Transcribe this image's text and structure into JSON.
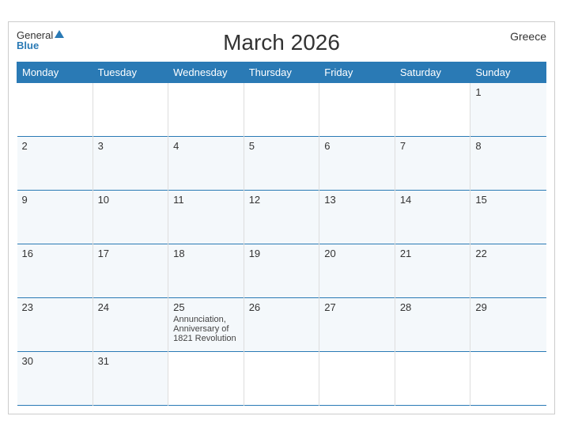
{
  "header": {
    "title": "March 2026",
    "country": "Greece",
    "logo_general": "General",
    "logo_blue": "Blue"
  },
  "days_of_week": [
    "Monday",
    "Tuesday",
    "Wednesday",
    "Thursday",
    "Friday",
    "Saturday",
    "Sunday"
  ],
  "weeks": [
    [
      {
        "day": "",
        "empty": true
      },
      {
        "day": "",
        "empty": true
      },
      {
        "day": "",
        "empty": true
      },
      {
        "day": "",
        "empty": true
      },
      {
        "day": "",
        "empty": true
      },
      {
        "day": "",
        "empty": true
      },
      {
        "day": "1",
        "holiday": ""
      }
    ],
    [
      {
        "day": "2",
        "holiday": ""
      },
      {
        "day": "3",
        "holiday": ""
      },
      {
        "day": "4",
        "holiday": ""
      },
      {
        "day": "5",
        "holiday": ""
      },
      {
        "day": "6",
        "holiday": ""
      },
      {
        "day": "7",
        "holiday": ""
      },
      {
        "day": "8",
        "holiday": ""
      }
    ],
    [
      {
        "day": "9",
        "holiday": ""
      },
      {
        "day": "10",
        "holiday": ""
      },
      {
        "day": "11",
        "holiday": ""
      },
      {
        "day": "12",
        "holiday": ""
      },
      {
        "day": "13",
        "holiday": ""
      },
      {
        "day": "14",
        "holiday": ""
      },
      {
        "day": "15",
        "holiday": ""
      }
    ],
    [
      {
        "day": "16",
        "holiday": ""
      },
      {
        "day": "17",
        "holiday": ""
      },
      {
        "day": "18",
        "holiday": ""
      },
      {
        "day": "19",
        "holiday": ""
      },
      {
        "day": "20",
        "holiday": ""
      },
      {
        "day": "21",
        "holiday": ""
      },
      {
        "day": "22",
        "holiday": ""
      }
    ],
    [
      {
        "day": "23",
        "holiday": ""
      },
      {
        "day": "24",
        "holiday": ""
      },
      {
        "day": "25",
        "holiday": "Annunciation, Anniversary of 1821 Revolution"
      },
      {
        "day": "26",
        "holiday": ""
      },
      {
        "day": "27",
        "holiday": ""
      },
      {
        "day": "28",
        "holiday": ""
      },
      {
        "day": "29",
        "holiday": ""
      }
    ],
    [
      {
        "day": "30",
        "holiday": ""
      },
      {
        "day": "31",
        "holiday": ""
      },
      {
        "day": "",
        "empty": true
      },
      {
        "day": "",
        "empty": true
      },
      {
        "day": "",
        "empty": true
      },
      {
        "day": "",
        "empty": true
      },
      {
        "day": "",
        "empty": true
      }
    ]
  ]
}
